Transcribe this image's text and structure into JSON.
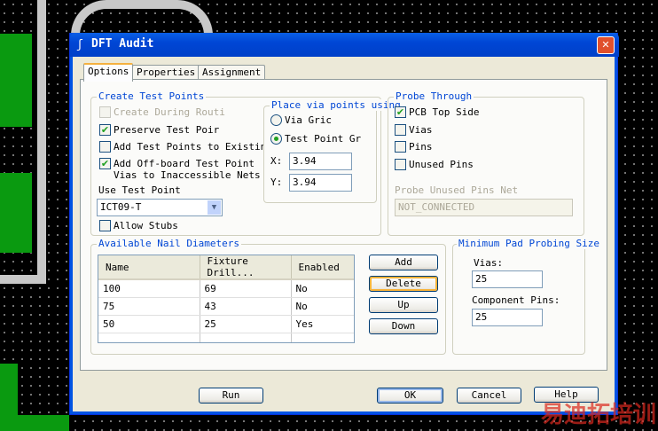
{
  "window": {
    "title": "DFT Audit",
    "close": "✕"
  },
  "tabs": [
    "Options",
    "Properties",
    "Assignment"
  ],
  "create_test_points": {
    "legend": "Create Test Points",
    "create_during_routing": {
      "label": "Create During Routi",
      "checked": false,
      "disabled": true
    },
    "preserve_test_points": {
      "label": "Preserve Test Poir",
      "checked": true
    },
    "add_to_existing": {
      "label": "Add Test Points to Existing",
      "checked": false
    },
    "add_offboard": {
      "label1": "Add Off-board Test Point",
      "label2": "Vias to Inaccessible Nets",
      "checked": true
    },
    "use_test_point_label": "Use Test Point",
    "use_test_point_value": "ICT09-T",
    "allow_stubs": {
      "label": "Allow Stubs",
      "checked": false
    }
  },
  "place_via": {
    "legend": "Place via points using",
    "via_grid": "Via Gric",
    "test_point_grid": "Test Point Gr",
    "selected": "test_point_grid",
    "x_label": "X:",
    "x_value": "3.94",
    "y_label": "Y:",
    "y_value": "3.94"
  },
  "probe_through": {
    "legend": "Probe Through",
    "items": [
      {
        "label": "PCB Top Side",
        "checked": true
      },
      {
        "label": "Vias",
        "checked": false
      },
      {
        "label": "Pins",
        "checked": false
      },
      {
        "label": "Unused Pins",
        "checked": false
      }
    ],
    "unused_net_label": "Probe Unused Pins Net",
    "unused_net_value": "NOT_CONNECTED"
  },
  "nails": {
    "legend": "Available Nail Diameters",
    "columns": [
      "Name",
      "Fixture Drill...",
      "Enabled"
    ],
    "rows": [
      [
        "100",
        "69",
        "No"
      ],
      [
        "75",
        "43",
        "No"
      ],
      [
        "50",
        "25",
        "Yes"
      ]
    ],
    "buttons": {
      "add": "Add",
      "delete": "Delete",
      "up": "Up",
      "down": "Down"
    }
  },
  "min_pad": {
    "legend": "Minimum Pad Probing Size",
    "vias_label": "Vias:",
    "vias_value": "25",
    "pins_label": "Component Pins:",
    "pins_value": "25"
  },
  "footer": {
    "run": "Run",
    "ok": "OK",
    "cancel": "Cancel",
    "help": "Help"
  },
  "watermark": "易迪拓培训"
}
